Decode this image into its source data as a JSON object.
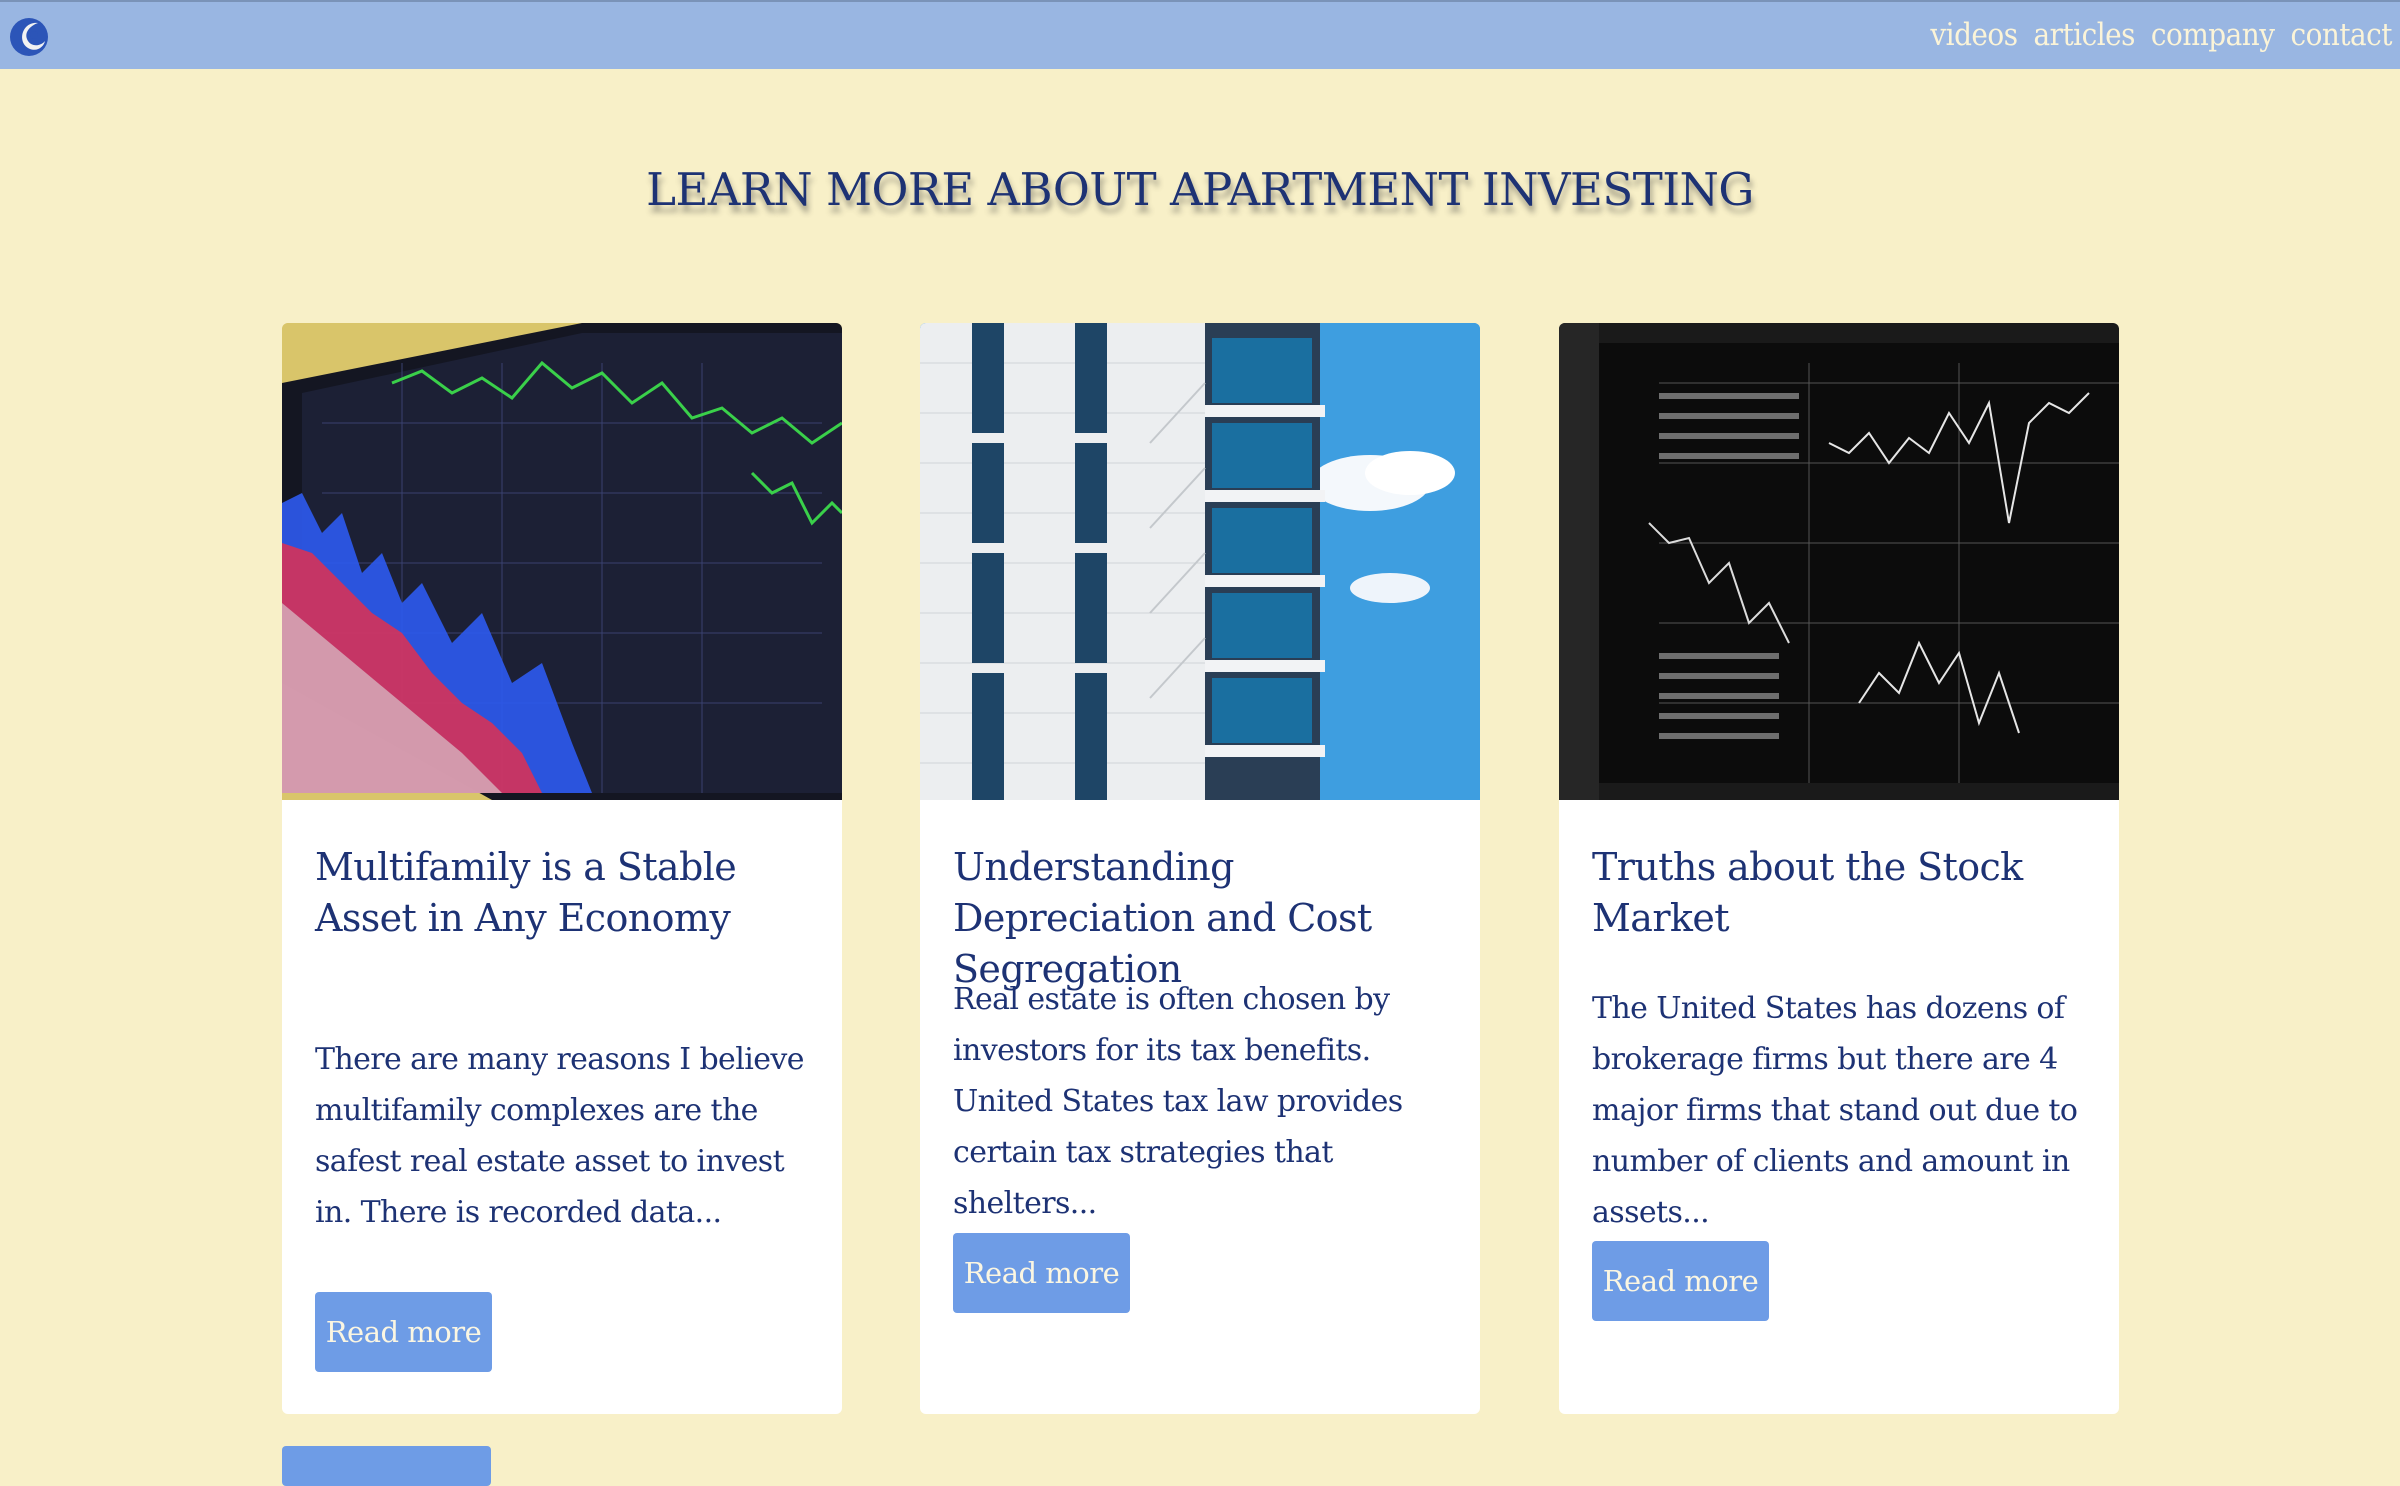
{
  "nav": {
    "links": [
      "videos",
      "articles",
      "company",
      "contact"
    ]
  },
  "main": {
    "title": "LEARN MORE ABOUT APARTMENT INVESTING"
  },
  "cards": [
    {
      "image": "tablet-stock-chart-image",
      "title": "Multifamily is a Stable Asset in Any Economy",
      "text": "There are many reasons I believe multifamily complexes are the safest real estate asset to invest in. There is recorded data...",
      "button": "Read more"
    },
    {
      "image": "apartment-building-image",
      "title": "Understanding Depreciation and Cost Segregation",
      "text": "Real estate is often chosen by investors for its tax benefits. United States tax law provides certain tax strategies that shelters...",
      "button": "Read more"
    },
    {
      "image": "stock-market-monitor-image",
      "title": "Truths about the Stock Market",
      "text": "The United States has dozens of brokerage firms but there are 4 major firms that stand out due to number of clients and amount in assets...",
      "button": "Read more"
    }
  ],
  "colors": {
    "background": "#f8f0c8",
    "navbar": "#99b6e2",
    "heading": "#1d3274",
    "button": "#6e9ce6"
  }
}
